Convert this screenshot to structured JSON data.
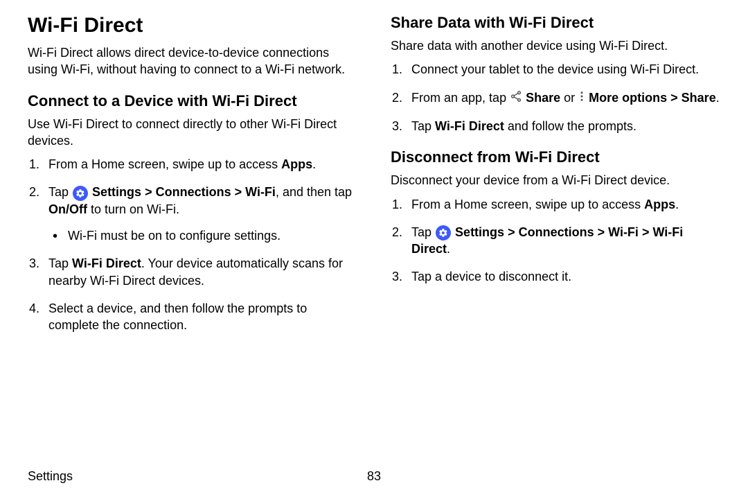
{
  "left": {
    "title": "Wi-Fi Direct",
    "intro": "Wi-Fi Direct allows direct device-to-device connections using Wi-Fi, without having to connect to a Wi-Fi network.",
    "section1": {
      "heading": "Connect to a Device with Wi-Fi Direct",
      "intro": "Use Wi-Fi Direct to connect directly to other Wi-Fi Direct devices.",
      "step1_a": "From a Home screen, swipe up to access ",
      "step1_b": "Apps",
      "step1_c": ".",
      "step2_a": "Tap ",
      "step2_b": "Settings",
      "step2_c": " > ",
      "step2_d": "Connections",
      "step2_e": " > ",
      "step2_f": "Wi-Fi",
      "step2_g": ", and then tap ",
      "step2_h": "On/Off",
      "step2_i": " to turn on Wi-Fi.",
      "sub1": "Wi-Fi must be on to configure settings.",
      "step3_a": "Tap ",
      "step3_b": "Wi-Fi Direct",
      "step3_c": ". Your device automatically scans for nearby Wi-Fi Direct devices.",
      "step4": "Select a device, and then follow the prompts to complete the connection."
    }
  },
  "right": {
    "section1": {
      "heading": "Share Data with Wi-Fi Direct",
      "intro": "Share data with another device using Wi-Fi Direct.",
      "step1": "Connect your tablet to the device using Wi-Fi Direct.",
      "step2_a": "From an app, tap ",
      "step2_b": "Share",
      "step2_c": " or ",
      "step2_d": "More options",
      "step2_e": " > ",
      "step2_f": "Share",
      "step2_g": ".",
      "step3_a": "Tap ",
      "step3_b": "Wi-Fi Direct",
      "step3_c": " and follow the prompts."
    },
    "section2": {
      "heading": "Disconnect from Wi-Fi Direct",
      "intro": "Disconnect your device from a Wi-Fi Direct device.",
      "step1_a": "From a Home screen, swipe up to access ",
      "step1_b": "Apps",
      "step1_c": ".",
      "step2_a": "Tap ",
      "step2_b": "Settings",
      "step2_c": " > ",
      "step2_d": "Connections",
      "step2_e": " > ",
      "step2_f": "Wi-Fi",
      "step2_g": " > ",
      "step2_h": "Wi-Fi Direct",
      "step2_i": ".",
      "step3": "Tap a device to disconnect it."
    }
  },
  "footer": {
    "label": "Settings",
    "page": "83"
  }
}
